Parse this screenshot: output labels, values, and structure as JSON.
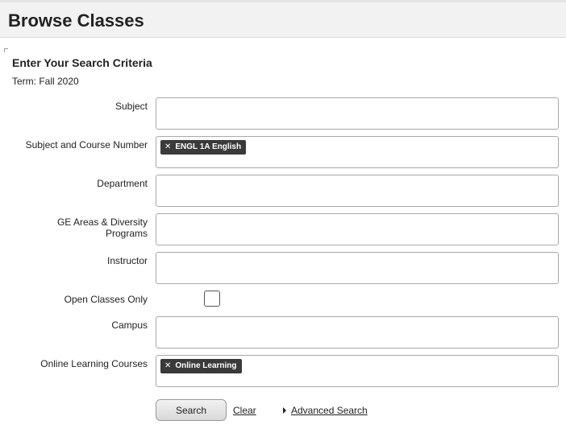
{
  "header": {
    "title": "Browse Classes"
  },
  "criteria": {
    "section_title": "Enter Your Search Criteria",
    "term": "Term: Fall 2020"
  },
  "fields": {
    "subject": {
      "label": "Subject",
      "value": ""
    },
    "subject_course": {
      "label": "Subject and Course Number",
      "chips": [
        {
          "label": "ENGL 1A English",
          "remove_icon": "close-icon"
        }
      ]
    },
    "department": {
      "label": "Department",
      "value": ""
    },
    "ge_areas": {
      "label_line1": "GE Areas & Diversity",
      "label_line2": "Programs",
      "value": ""
    },
    "instructor": {
      "label": "Instructor",
      "value": ""
    },
    "open_classes": {
      "label": "Open Classes Only",
      "checked": false
    },
    "campus": {
      "label": "Campus",
      "value": ""
    },
    "online_learning": {
      "label": "Online Learning Courses",
      "chips": [
        {
          "label": "Online Learning",
          "remove_icon": "close-icon"
        }
      ]
    }
  },
  "actions": {
    "search_label": "Search",
    "clear_label": "Clear",
    "advanced_label": "Advanced Search"
  }
}
